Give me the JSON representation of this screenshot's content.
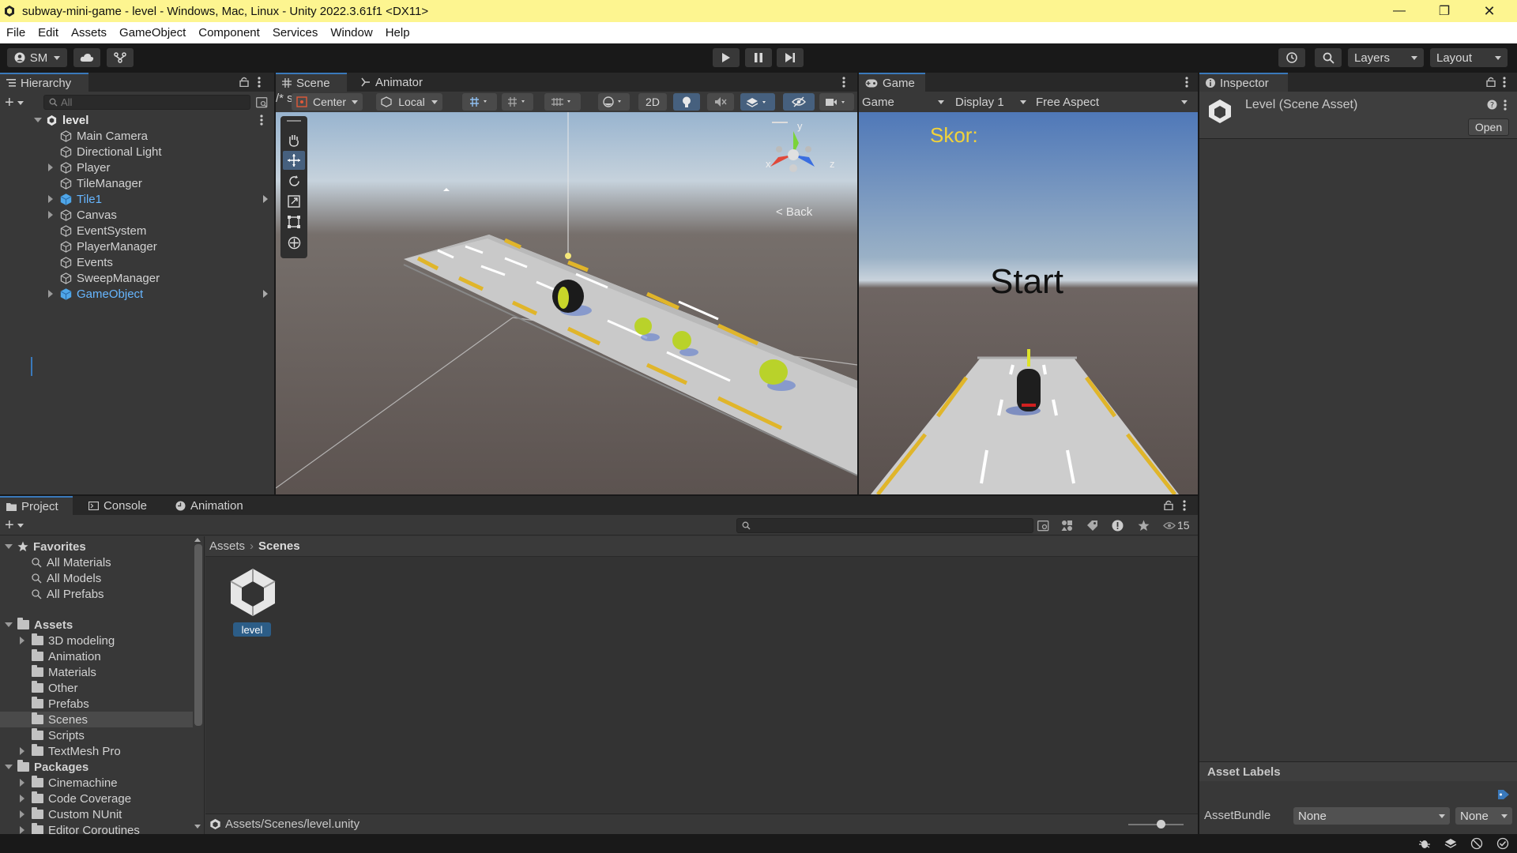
{
  "window": {
    "title": "subway-mini-game - level - Windows, Mac, Linux - Unity 2022.3.61f1 <DX11>"
  },
  "menu": [
    "File",
    "Edit",
    "Assets",
    "GameObject",
    "Component",
    "Services",
    "Window",
    "Help"
  ],
  "toolbar": {
    "account": "SM",
    "layers_label": "Layers",
    "layout_label": "Layout"
  },
  "hierarchy": {
    "tab": "Hierarchy",
    "search_placeholder": "All",
    "scene_name": "level",
    "items": [
      {
        "label": "Main Camera",
        "expandable": false,
        "highlight": false
      },
      {
        "label": "Directional Light",
        "expandable": false,
        "highlight": false
      },
      {
        "label": "Player",
        "expandable": true,
        "highlight": false
      },
      {
        "label": "TileManager",
        "expandable": false,
        "highlight": false
      },
      {
        "label": "Tile1",
        "expandable": true,
        "highlight": true
      },
      {
        "label": "Canvas",
        "expandable": true,
        "highlight": false
      },
      {
        "label": "EventSystem",
        "expandable": false,
        "highlight": false
      },
      {
        "label": "PlayerManager",
        "expandable": false,
        "highlight": false
      },
      {
        "label": "Events",
        "expandable": false,
        "highlight": false
      },
      {
        "label": "SweepManager",
        "expandable": false,
        "highlight": false
      },
      {
        "label": "GameObject",
        "expandable": true,
        "highlight": true
      }
    ]
  },
  "scene": {
    "tabs": [
      "Scene",
      "Animator"
    ],
    "pivot": "Center",
    "space": "Local",
    "mode_2d": "2D",
    "back_label": "< Back",
    "gizmo_x": "x",
    "gizmo_y": "y",
    "gizmo_z": "z"
  },
  "game": {
    "tab": "Game",
    "mode": "Game",
    "display": "Display 1",
    "aspect": "Free Aspect",
    "score_label": "Skor:",
    "start_label": "Start"
  },
  "inspector": {
    "tab": "Inspector",
    "title": "Level (Scene Asset)",
    "open_button": "Open",
    "asset_labels": "Asset Labels",
    "assetbundle_label": "AssetBundle",
    "assetbundle_value": "None",
    "variant_value": "None"
  },
  "project": {
    "tabs": [
      "Project",
      "Console",
      "Animation"
    ],
    "favorites_label": "Favorites",
    "favorites": [
      "All Materials",
      "All Models",
      "All Prefabs"
    ],
    "assets_label": "Assets",
    "asset_folders": [
      {
        "label": "3D modeling",
        "expandable": true,
        "selected": false
      },
      {
        "label": "Animation",
        "expandable": false,
        "selected": false
      },
      {
        "label": "Materials",
        "expandable": false,
        "selected": false
      },
      {
        "label": "Other",
        "expandable": false,
        "selected": false
      },
      {
        "label": "Prefabs",
        "expandable": false,
        "selected": false
      },
      {
        "label": "Scenes",
        "expandable": false,
        "selected": true
      },
      {
        "label": "Scripts",
        "expandable": false,
        "selected": false
      },
      {
        "label": "TextMesh Pro",
        "expandable": true,
        "selected": false
      }
    ],
    "packages_label": "Packages",
    "packages": [
      "Cinemachine",
      "Code Coverage",
      "Custom NUnit",
      "Editor Coroutines"
    ],
    "breadcrumb": [
      "Assets",
      "Scenes"
    ],
    "asset_name": "level",
    "path": "Assets/Scenes/level.unity",
    "hidden_count": "15"
  },
  "colors": {
    "accent": "#3a79bb",
    "titlebar": "#fdf590",
    "highlight_text": "#67b6ff",
    "panel": "#383838",
    "score_text": "#f2d33a"
  }
}
